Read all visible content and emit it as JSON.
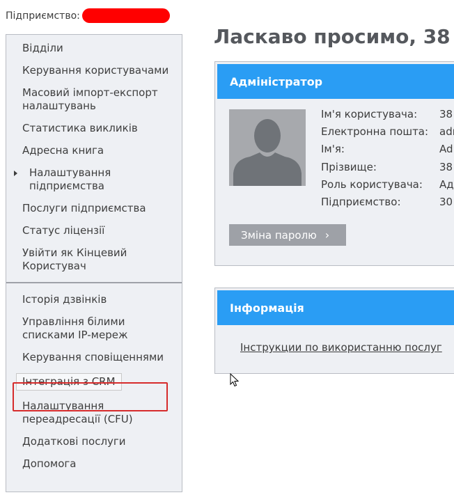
{
  "header": {
    "enterprise_label": "Підприємство:",
    "page_title": "Ласкаво просимо, 38"
  },
  "sidebar": {
    "group1": [
      {
        "label": "Відділи"
      },
      {
        "label": "Керування користувачами"
      },
      {
        "label": "Масовий імпорт-експорт налаштувань"
      },
      {
        "label": "Статистика викликів"
      },
      {
        "label": "Адресна книга"
      },
      {
        "label": "Налаштування підприємства"
      },
      {
        "label": "Послуги підприємства"
      },
      {
        "label": "Статус ліцензії"
      },
      {
        "label": "Увійти як Кінцевий Користувач"
      }
    ],
    "group2": [
      {
        "label": "Історія дзвінків"
      },
      {
        "label": "Управління білими списками IP-мереж"
      },
      {
        "label": "Керування сповіщеннями"
      },
      {
        "label": "Інтеграція з CRM"
      },
      {
        "label": "Налаштування переадресації (CFU)"
      },
      {
        "label": "Додаткові послуги"
      },
      {
        "label": "Допомога"
      }
    ]
  },
  "admin_panel": {
    "title": "Адміністратор",
    "fields": [
      {
        "label": "Ім'я користувача:",
        "value": "38"
      },
      {
        "label": "Електронна пошта:",
        "value": "adr"
      },
      {
        "label": "Ім'я:",
        "value": "Ad"
      },
      {
        "label": "Прізвище:",
        "value": "38"
      },
      {
        "label": "Роль користувача:",
        "value": "Ад"
      },
      {
        "label": "Підприємство:",
        "value": "30"
      }
    ],
    "change_password_button": "Зміна паролю",
    "button_chevron": "›"
  },
  "info_panel": {
    "title": "Інформація",
    "link": "Інструкции по використанню послуг"
  },
  "colors": {
    "accent": "#2a9df4",
    "highlight": "#d62b2b",
    "redaction": "#ff0000",
    "button": "#9ea1a7"
  },
  "icons": {
    "arrow": "caret-right-icon",
    "avatar": "user-silhouette-icon",
    "cursor": "mouse-pointer-icon"
  }
}
